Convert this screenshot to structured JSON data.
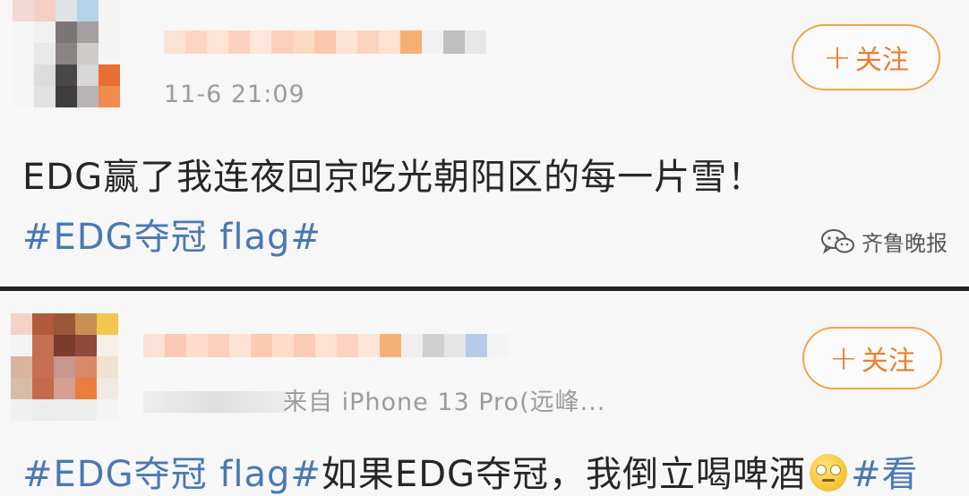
{
  "posts": [
    {
      "time": "11-6 21:09",
      "follow_label": "关注",
      "text_plain": "EDG赢了我连夜回京吃光朝阳区的每一片雪！",
      "topic": "#EDG夺冠 flag#"
    },
    {
      "source": "来自 iPhone 13 Pro(远峰...",
      "follow_label": "关注",
      "topic": "#EDG夺冠 flag#",
      "text_plain": "如果EDG夺冠，我倒立喝啤酒",
      "topic_tail": "#看"
    }
  ],
  "watermark": {
    "text": "齐鲁晚报",
    "icon": "wechat-icon"
  },
  "colors": {
    "accent_orange": "#ee7c2e",
    "follow_border": "#f0a54a",
    "topic_blue": "#4a78b5",
    "divider": "#222222"
  }
}
